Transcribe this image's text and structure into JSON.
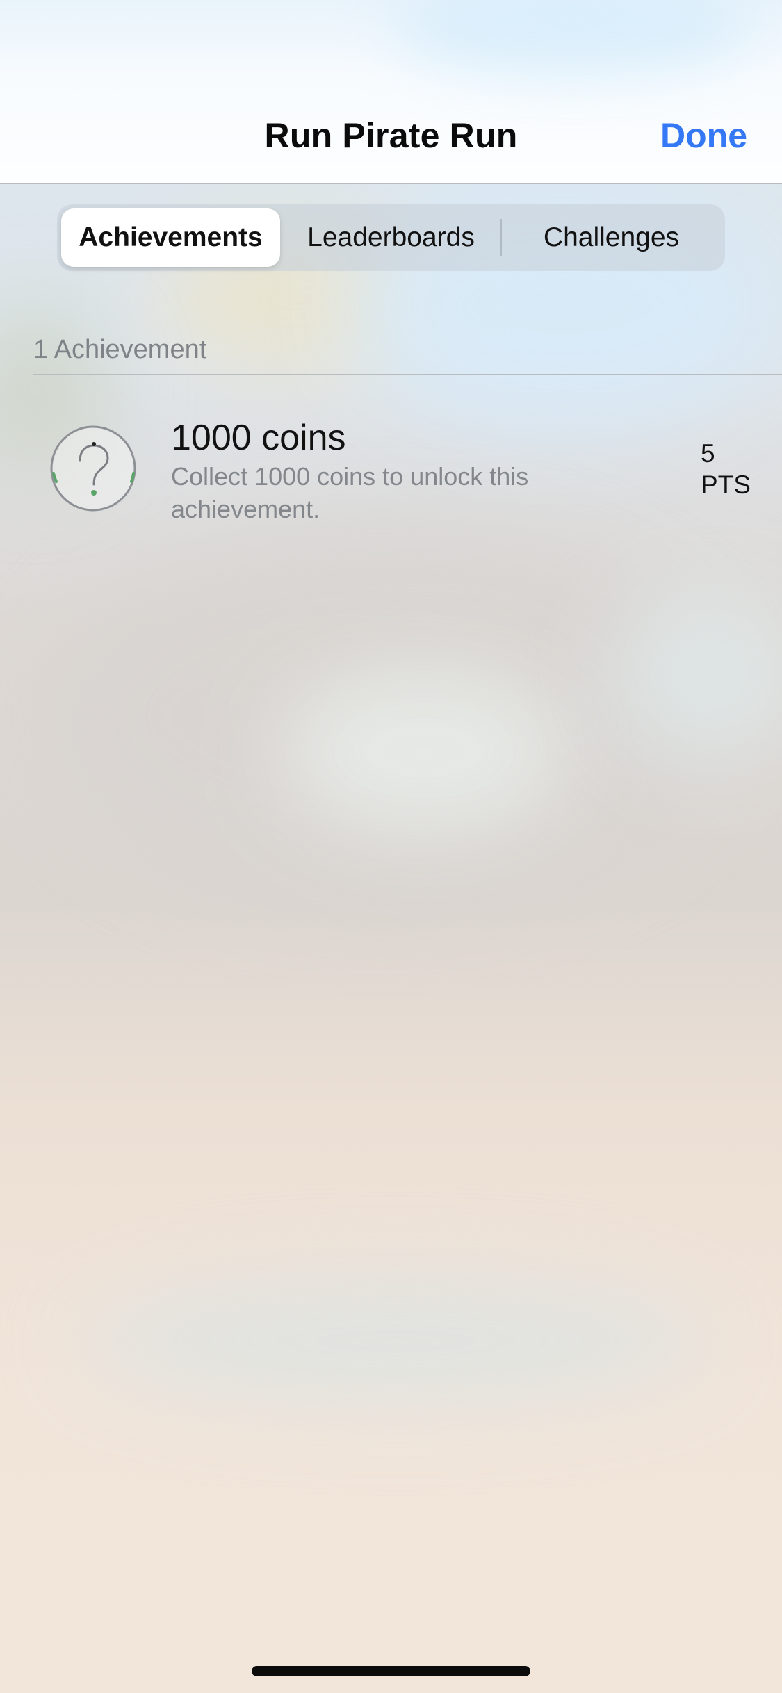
{
  "nav": {
    "title": "Run Pirate Run",
    "done_label": "Done"
  },
  "tabs": [
    {
      "label": "Achievements",
      "selected": true
    },
    {
      "label": "Leaderboards",
      "selected": false
    },
    {
      "label": "Challenges",
      "selected": false
    }
  ],
  "section": {
    "header": "1 Achievement"
  },
  "achievements": [
    {
      "icon": "question-mark-icon",
      "title": "1000 coins",
      "description": "Collect 1000 coins to unlock this achievement.",
      "points_value": "5",
      "points_unit": "PTS"
    }
  ],
  "colors": {
    "accent": "#3478f6",
    "progress": "#4caf50"
  }
}
